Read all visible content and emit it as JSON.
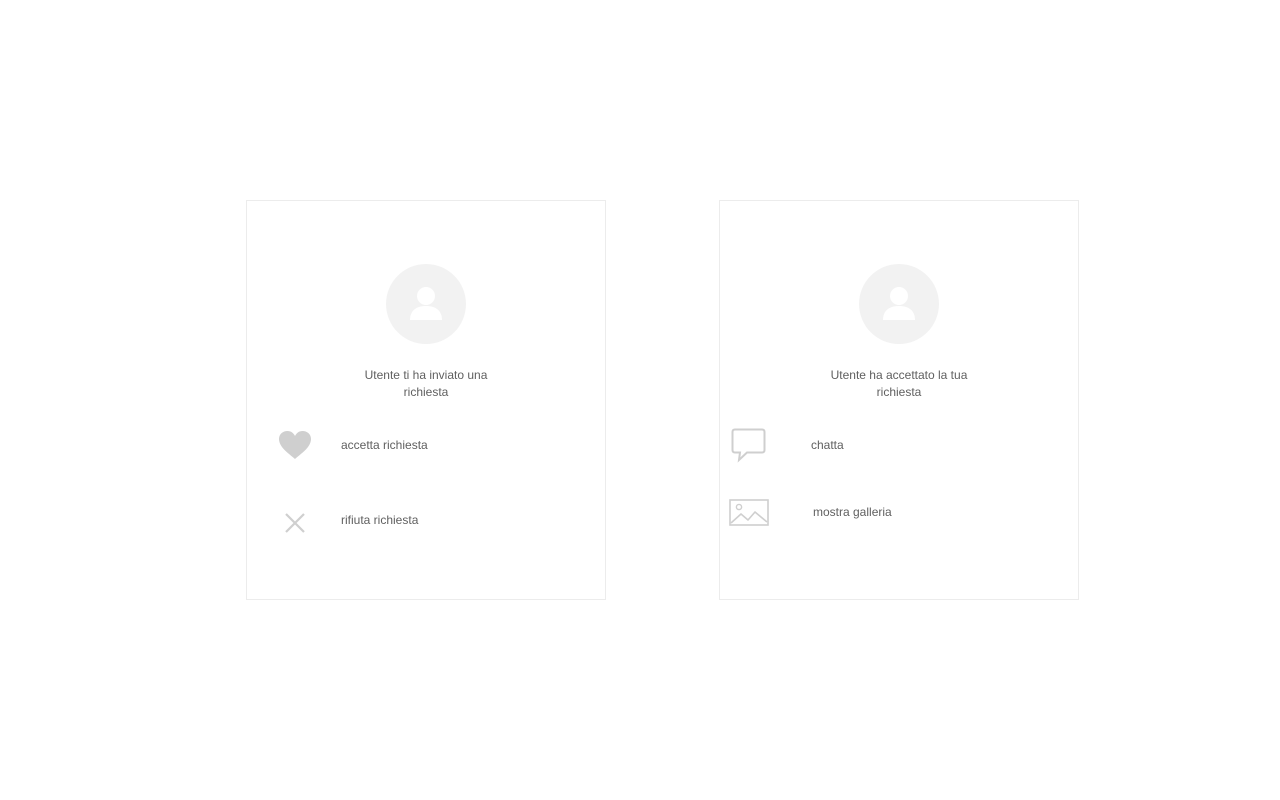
{
  "cards": [
    {
      "message": "Utente ti ha inviato una richiesta",
      "actions": [
        {
          "label": "accetta richiesta",
          "icon": "heart-icon"
        },
        {
          "label": "rifiuta richiesta",
          "icon": "close-icon"
        }
      ]
    },
    {
      "message": "Utente ha accettato la tua richiesta",
      "actions": [
        {
          "label": "chatta",
          "icon": "chat-bubble-icon"
        },
        {
          "label": "mostra galleria",
          "icon": "image-gallery-icon"
        }
      ]
    }
  ],
  "colors": {
    "icon_gray": "#cfcfcf",
    "avatar_bg": "#f2f2f2",
    "card_border": "#ececec",
    "text": "#606060"
  }
}
